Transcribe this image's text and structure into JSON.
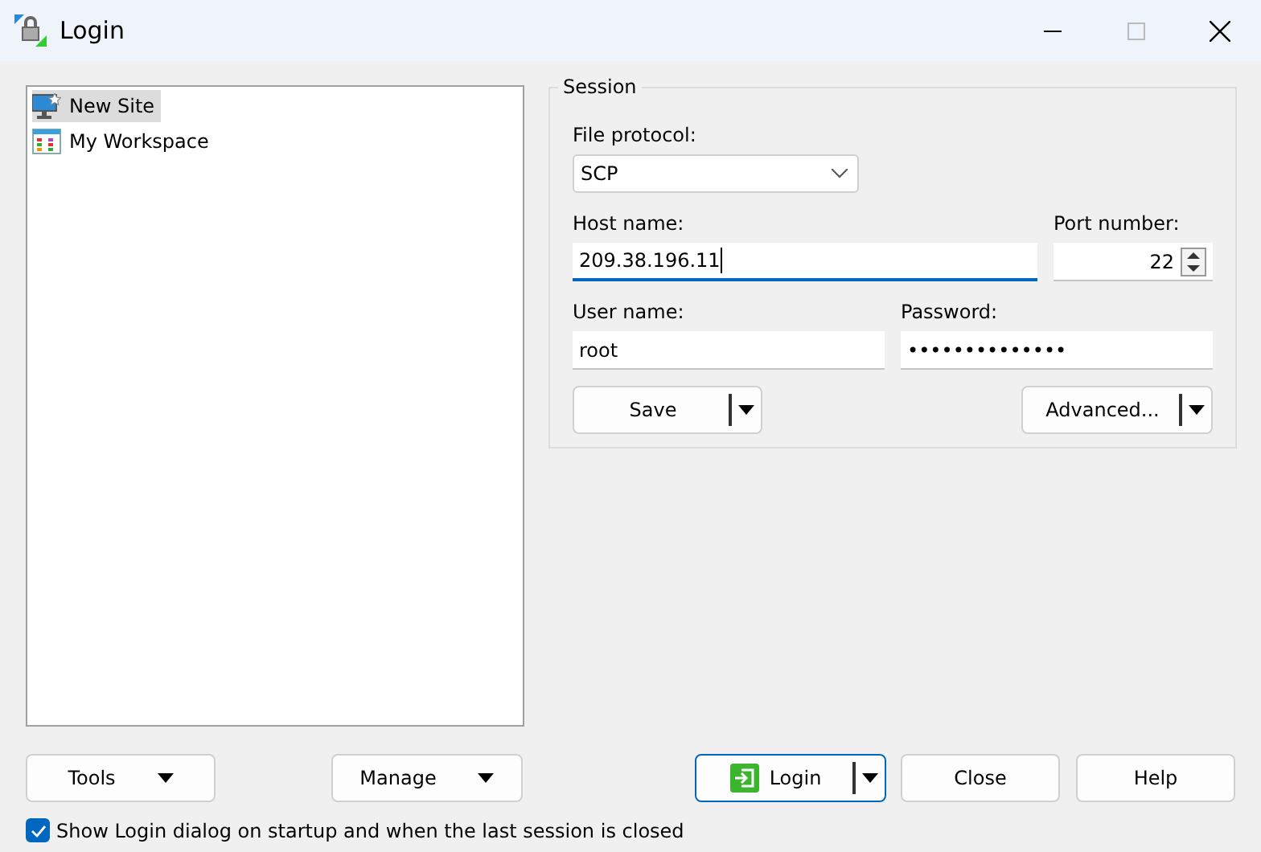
{
  "window": {
    "title": "Login"
  },
  "sites": [
    {
      "label": "New Site",
      "kind": "site",
      "selected": true
    },
    {
      "label": "My Workspace",
      "kind": "workspace",
      "selected": false
    }
  ],
  "session": {
    "legend": "Session",
    "protocol_label": "File protocol:",
    "protocol": "SCP",
    "host_label": "Host name:",
    "host": "209.38.196.11",
    "port_label": "Port number:",
    "port": "22",
    "user_label": "User name:",
    "user": "root",
    "password_label": "Password:",
    "password": "••••••••••••••",
    "save": "Save",
    "advanced": "Advanced..."
  },
  "buttons": {
    "tools": "Tools",
    "manage": "Manage",
    "login": "Login",
    "close": "Close",
    "help": "Help"
  },
  "show_login": {
    "label": "Show Login dialog on startup and when the last session is closed",
    "checked": true
  }
}
